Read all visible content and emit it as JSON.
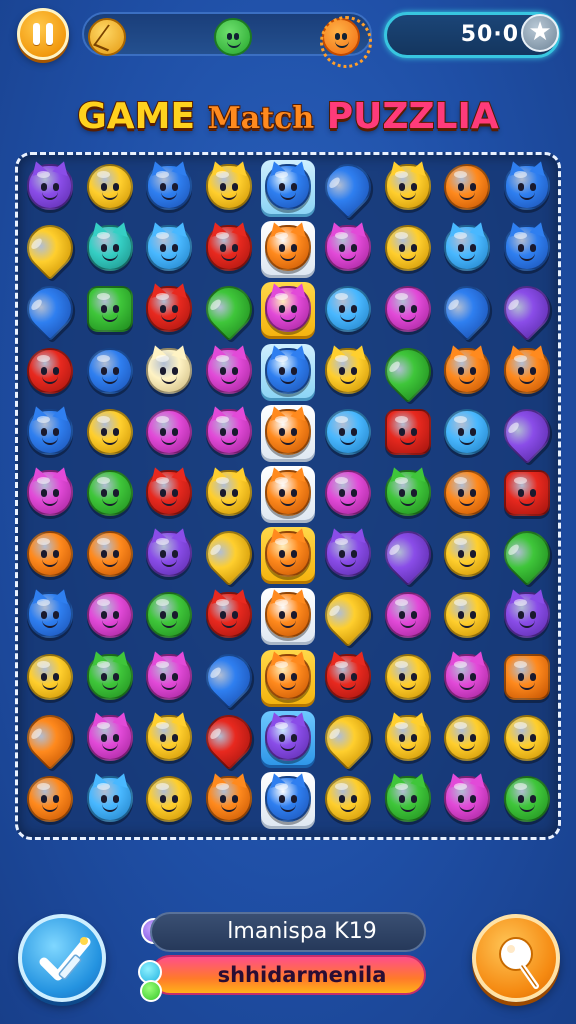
{
  "hud": {
    "score": "50·0",
    "pause_icon": "pause-icon",
    "star_icon": "star-icon",
    "track_icons": [
      "cracked-coin-icon",
      "green-face-icon",
      "orange-monster-icon"
    ]
  },
  "title": {
    "word1": "GAME",
    "word2": "Match",
    "word3": "PUZZLIA"
  },
  "board": {
    "columns": 9,
    "rows": 11,
    "highlight_column": 4,
    "colors": {
      "purple": "#8a4de8",
      "yellow": "#ffcf2e",
      "blue": "#2f7ff0",
      "orange": "#ff8a1e",
      "green": "#3fc63a",
      "red": "#e8291f",
      "magenta": "#e24ad8",
      "teal": "#35cfc4",
      "sky": "#49b8ff",
      "cream": "#fff3c4"
    },
    "cells": [
      [
        "purple-cat",
        "yellow-circle",
        "blue-cat",
        "yellow-cat",
        "blue-cat",
        "blue-drop",
        "yellow-cat",
        "orange-circle",
        "blue-cat"
      ],
      [
        "yellow-drop",
        "teal-cat",
        "sky-cat",
        "red-cat",
        "orange-cat",
        "magenta-cat",
        "yellow-circle",
        "sky-cat",
        "blue-cat"
      ],
      [
        "blue-drop",
        "green-square",
        "red-cat",
        "green-drop",
        "magenta-cat",
        "sky-circle",
        "magenta-circle",
        "blue-drop",
        "purple-drop"
      ],
      [
        "red-circle",
        "blue-circle",
        "cream-cat",
        "magenta-cat",
        "blue-cat",
        "yellow-cat",
        "green-drop",
        "orange-cat",
        "orange-cat"
      ],
      [
        "blue-cat",
        "yellow-circle",
        "magenta-circle",
        "magenta-cat",
        "orange-cat",
        "sky-circle",
        "red-square",
        "sky-circle",
        "purple-drop"
      ],
      [
        "magenta-cat",
        "green-circle",
        "red-cat",
        "yellow-cat",
        "orange-cat",
        "magenta-circle",
        "green-cat",
        "orange-circle",
        "red-square"
      ],
      [
        "orange-circle",
        "orange-circle",
        "purple-cat",
        "yellow-drop",
        "orange-cat",
        "purple-cat",
        "purple-drop",
        "yellow-circle",
        "green-drop"
      ],
      [
        "blue-cat",
        "magenta-circle",
        "green-circle",
        "red-cat",
        "orange-cat",
        "yellow-drop",
        "magenta-circle",
        "yellow-circle",
        "purple-cat"
      ],
      [
        "yellow-circle",
        "green-cat",
        "magenta-cat",
        "blue-drop",
        "orange-cat",
        "red-cat",
        "yellow-circle",
        "magenta-cat",
        "orange-square"
      ],
      [
        "orange-drop",
        "magenta-cat",
        "yellow-cat",
        "red-drop",
        "purple-cat",
        "yellow-drop",
        "yellow-cat",
        "yellow-circle",
        "yellow-circle"
      ],
      [
        "orange-circle",
        "sky-cat",
        "yellow-circle",
        "orange-cat",
        "blue-cat",
        "yellow-circle",
        "green-cat",
        "magenta-cat",
        "green-circle"
      ]
    ],
    "highlight_tiles": [
      "c",
      "w",
      "y",
      "c",
      "w",
      "w",
      "y",
      "w",
      "y",
      "b",
      "w"
    ]
  },
  "footer": {
    "left_button_icon": "check-ruler-icon",
    "right_button_icon": "pin-icon",
    "bar1_text": "lmanispa K19",
    "bar2_text": "shhidarmenila"
  }
}
